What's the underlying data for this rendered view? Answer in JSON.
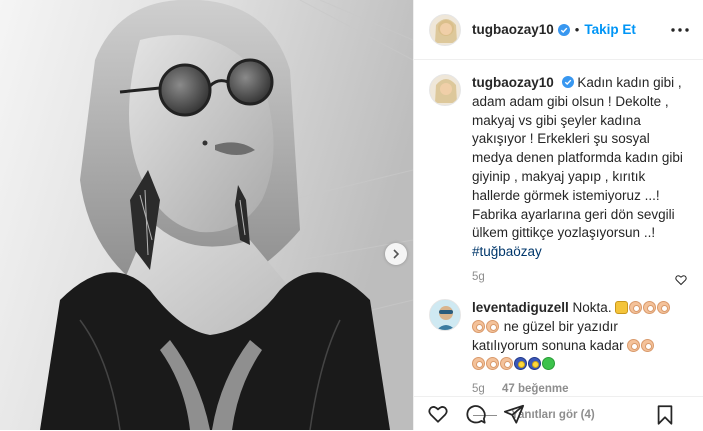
{
  "post": {
    "username": "tugbaozay10",
    "dot": "•",
    "follow_label": "Takip Et",
    "caption_text": "Kadın kadın gibi , adam adam gibi olsun ! Dekolte , makyaj vs gibi şeyler kadına yakışıyor ! Erkekleri şu sosyal medya denen platformda kadın gibi giyinip , makyaj yapıp , kırıtık hallerde görmek istemiyoruz ...! Fabrika ayarlarına geri dön sevgili ülkem gittikçe yozlaşıyorsun ..!",
    "caption_tag": "#tuğbaözay",
    "caption_time": "5g"
  },
  "comment": {
    "username": "leventadiguzell",
    "text_1": "Nokta.",
    "text_2": "ne güzel bir yazıdır",
    "text_3": "katılıyorum sonuna kadar",
    "time": "5g",
    "likes": "47 beğenme",
    "replies": "Yanıtları gör (4)"
  },
  "icons": {
    "verified": "verified-badge-icon",
    "more": "more-options-icon",
    "like": "heart-icon",
    "comment": "comment-icon",
    "share": "share-icon",
    "save": "bookmark-icon",
    "next": "chevron-right-icon"
  },
  "colors": {
    "accent": "#0095f6",
    "tag": "#00376b",
    "muted": "#8e8e8e"
  }
}
